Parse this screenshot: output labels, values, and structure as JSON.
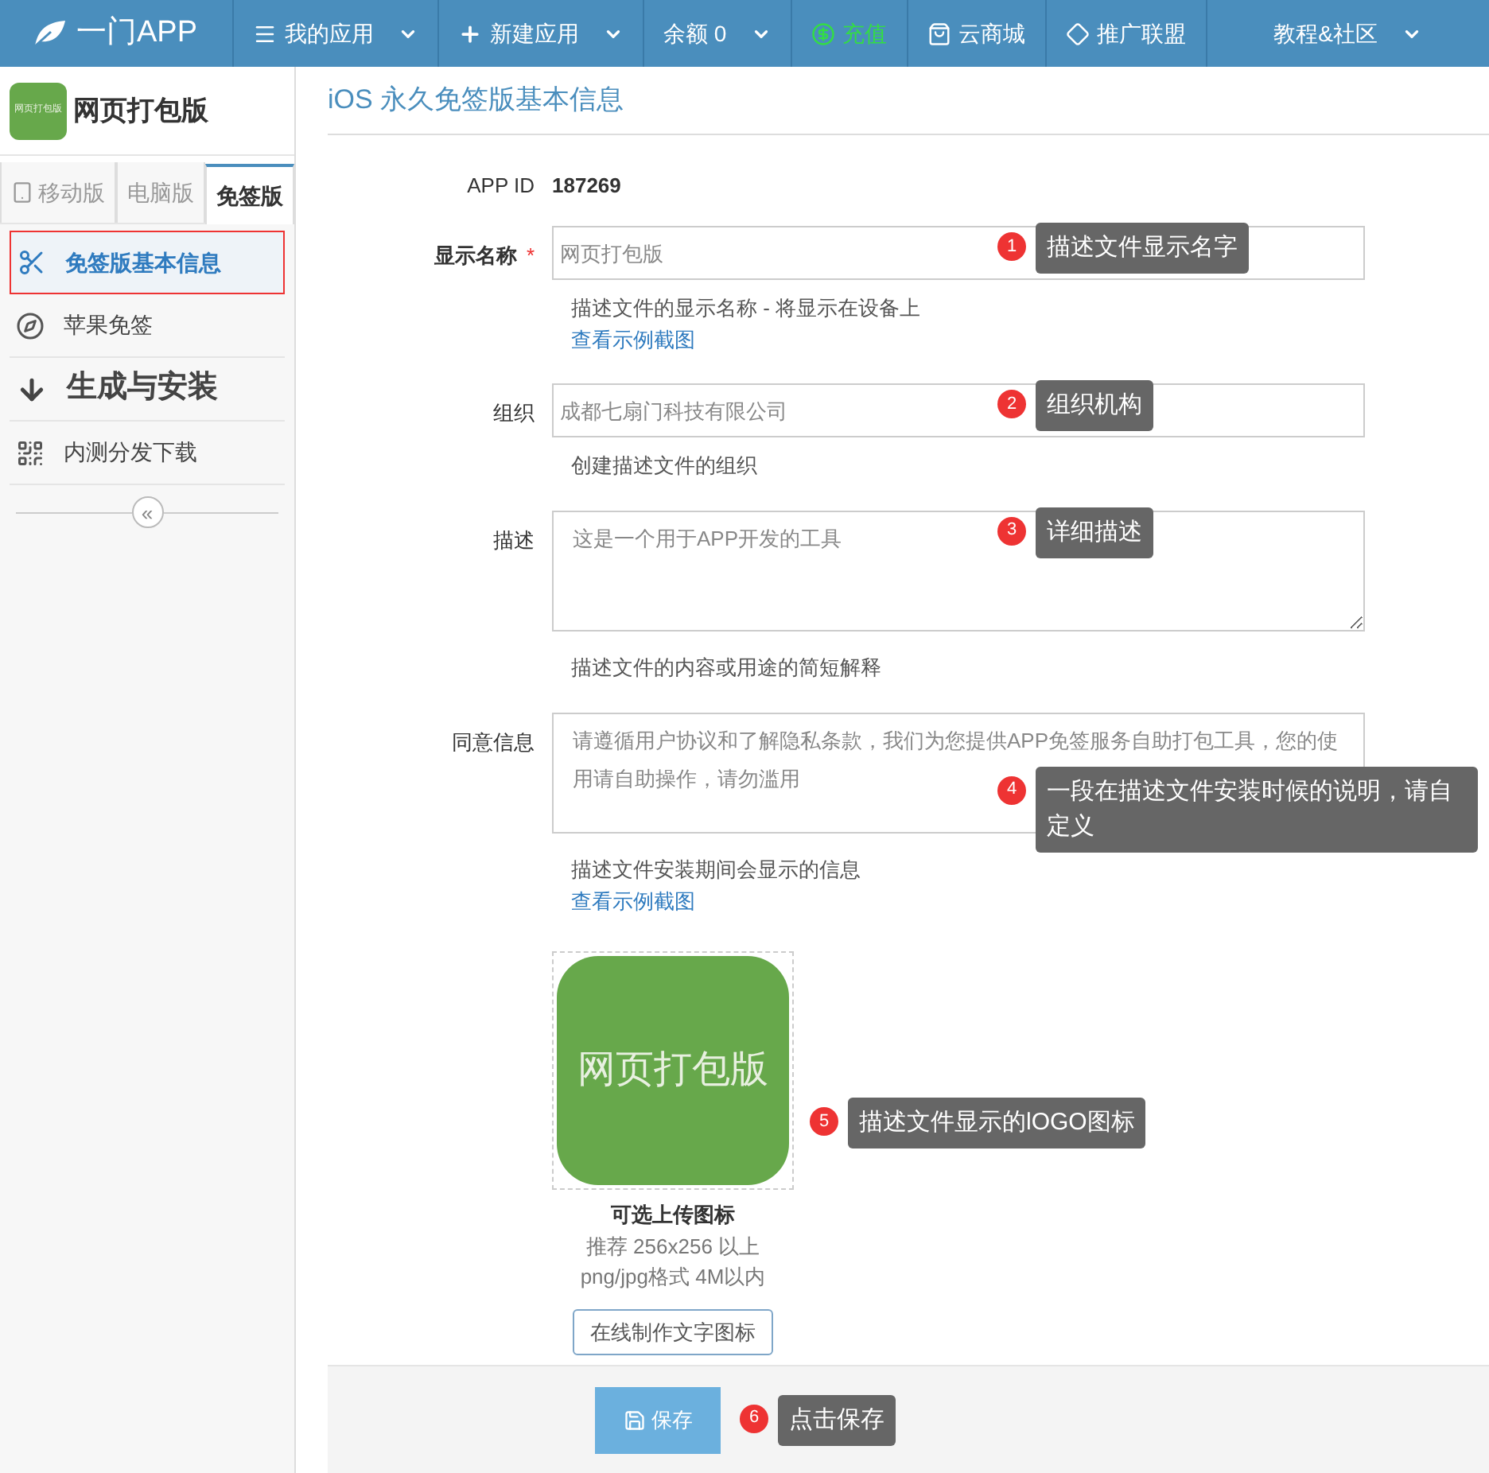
{
  "navbar": {
    "brand": "一门APP",
    "items": [
      {
        "label": "我的应用",
        "kind": "menu",
        "dropdown": true,
        "highlight": false
      },
      {
        "label": "新建应用",
        "kind": "create",
        "dropdown": true,
        "highlight": false
      },
      {
        "label": "余额 0",
        "kind": "plain",
        "dropdown": true,
        "highlight": false
      },
      {
        "label": "充值",
        "kind": "recharge",
        "dropdown": false,
        "highlight": true
      },
      {
        "label": "云商城",
        "kind": "shop",
        "dropdown": false,
        "highlight": false
      },
      {
        "label": "推广联盟",
        "kind": "affiliate",
        "dropdown": false,
        "highlight": false
      },
      {
        "label": "教程&社区",
        "kind": "plain",
        "dropdown": true,
        "highlight": false
      }
    ]
  },
  "sidebar": {
    "app_icon_text": "网页打包版",
    "app_name": "网页打包版",
    "tabs": [
      {
        "label": "移动版",
        "selected": false
      },
      {
        "label": "电脑版",
        "selected": false
      },
      {
        "label": "免签版",
        "selected": true
      }
    ],
    "items": [
      {
        "label": "免签版基本信息",
        "kind": "scissors",
        "selected": true
      },
      {
        "label": "苹果免签",
        "kind": "compass",
        "selected": false
      },
      {
        "label": "生成与安装",
        "kind": "binary",
        "selected": false
      },
      {
        "label": "内测分发下载",
        "kind": "qr",
        "selected": false
      }
    ],
    "collapse": "«"
  },
  "page_title": "iOS 永久免签版基本信息",
  "app_id": {
    "label": "APP ID",
    "value": "187269"
  },
  "fields": [
    {
      "label": "显示名称",
      "required_mark": "*",
      "kind": "input",
      "placeholder": "网页打包版",
      "help": "描述文件的显示名称 - 将显示在设备上",
      "link": "查看示例截图",
      "callout": {
        "number": "1",
        "text": "描述文件显示名字"
      }
    },
    {
      "label": "组织",
      "kind": "input",
      "placeholder": "成都七扇门科技有限公司",
      "help": "创建描述文件的组织",
      "callout": {
        "number": "2",
        "text": "组织机构"
      }
    },
    {
      "label": "描述",
      "kind": "textarea",
      "placeholder": "这是一个用于APP开发的工具",
      "help": "描述文件的内容或用途的简短解释",
      "callout": {
        "number": "3",
        "text": "详细描述"
      }
    },
    {
      "label": "同意信息",
      "kind": "textarea",
      "placeholder": "请遵循用户协议和了解隐私条款，我们为您提供APP免签服务自助打包工具，您的使用请自助操作，请勿滥用",
      "help": "描述文件安装期间会显示的信息",
      "link": "查看示例截图",
      "callout": {
        "number": "4",
        "text": "一段在描述文件安装时候的说明，请自定义"
      }
    }
  ],
  "icon_upload": {
    "icon_text": "网页打包版",
    "title": "可选上传图标",
    "hint_1": "推荐 256x256 以上",
    "hint_2": "png/jpg格式 4M以内",
    "button": "在线制作文字图标",
    "callout": {
      "number": "5",
      "text": "描述文件显示的lOGO图标"
    }
  },
  "footer": {
    "save": "保存",
    "callout": {
      "number": "6",
      "text": "点击保存"
    }
  }
}
